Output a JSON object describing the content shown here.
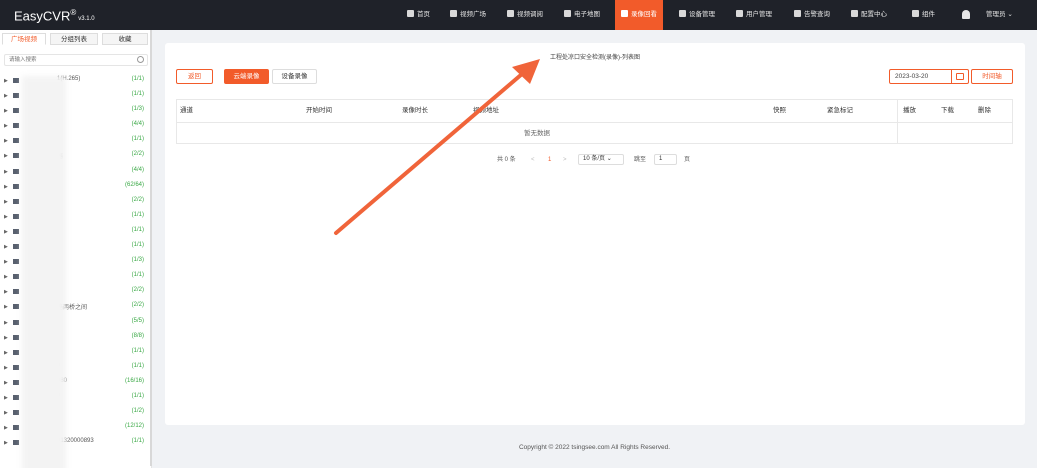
{
  "app": {
    "name": "EasyCVR",
    "reg": "®",
    "version": "v3.1.0"
  },
  "nav": [
    {
      "label": "首页"
    },
    {
      "label": "视频广场"
    },
    {
      "label": "视频调阅"
    },
    {
      "label": "电子地图"
    },
    {
      "label": "录像回看",
      "active": true
    },
    {
      "label": "设备管理"
    },
    {
      "label": "用户管理"
    },
    {
      "label": "告警查询"
    },
    {
      "label": "配置中心"
    },
    {
      "label": "组件"
    }
  ],
  "user": {
    "label": "管理员"
  },
  "sidebar": {
    "tabs": [
      "广场视频",
      "分组列表",
      "收藏"
    ],
    "search_placeholder": "请输入搜索",
    "items": [
      {
        "label": "1(H.265)",
        "count": "(1/1)"
      },
      {
        "label": "",
        "count": "(1/1)"
      },
      {
        "label": "",
        "count": "(1/3)"
      },
      {
        "label": "",
        "count": "(4/4)"
      },
      {
        "label": "",
        "count": "(1/1)"
      },
      {
        "label": "器",
        "count": "(2/2)"
      },
      {
        "label": "",
        "count": "(4/4)"
      },
      {
        "label": "",
        "count": "(62/64)"
      },
      {
        "label": "",
        "count": "(2/2)"
      },
      {
        "label": "",
        "count": "(1/1)"
      },
      {
        "label": "",
        "count": "(1/1)"
      },
      {
        "label": "",
        "count": "(1/1)"
      },
      {
        "label": "",
        "count": "(1/3)"
      },
      {
        "label": "",
        "count": "(1/1)"
      },
      {
        "label": "",
        "count": "(2/2)"
      },
      {
        "label": "路两桥之间",
        "count": "(2/2)"
      },
      {
        "label": "",
        "count": "(5/5)"
      },
      {
        "label": "",
        "count": "(8/8)"
      },
      {
        "label": "",
        "count": "(1/1)"
      },
      {
        "label": "3",
        "count": "(1/1)"
      },
      {
        "label": "380",
        "count": "(16/16)"
      },
      {
        "label": "3",
        "count": "(1/1)"
      },
      {
        "label": "",
        "count": "(1/2)"
      },
      {
        "label": "",
        "count": "(12/12)"
      },
      {
        "label": "01320000893",
        "count": "(1/1)"
      }
    ]
  },
  "main": {
    "title": "工程处凉口安全检测(录像)-列表图",
    "back_label": "返回",
    "tab_cloud": "云端录像",
    "tab_device": "设备录像",
    "date": "2023-03-20",
    "timeline_label": "时间轴",
    "columns": [
      "通道",
      "开始时间",
      "录像时长",
      "视频地址",
      "快照",
      "紧急标记",
      "播放",
      "下载",
      "删除"
    ],
    "empty_text": "暂无数据",
    "pager": {
      "total": "共 0 条",
      "prev": "<",
      "page": "1",
      "next": ">",
      "size": "10 条/页",
      "goto": "跳至",
      "goto_value": "1",
      "unit": "页"
    }
  },
  "footer": {
    "text": "Copyright © 2022 tsingsee.com All Rights Reserved."
  },
  "colors": {
    "accent": "#f25b2a",
    "topbar": "#1f2229",
    "count": "#39a845"
  }
}
